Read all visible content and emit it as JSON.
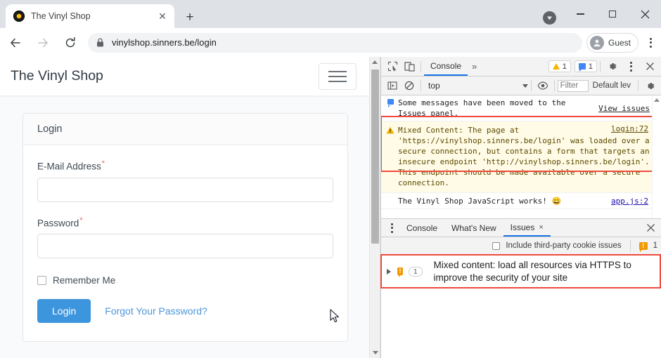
{
  "browser": {
    "tab": {
      "title": "The Vinyl Shop",
      "close_icon": "close-icon",
      "favicon": "vinyl-record-favicon"
    },
    "new_tab_label": "+",
    "window_controls": {
      "minimize": "minimize-icon",
      "maximize": "maximize-icon",
      "close": "close-icon"
    },
    "download_indicator": "download-icon",
    "nav": {
      "back": "back-arrow-icon",
      "forward": "forward-arrow-icon",
      "reload": "reload-icon"
    },
    "omnibox": {
      "lock_icon": "lock-icon",
      "host": "vinylshop.sinners.be",
      "path": "/login",
      "full_url": "vinylshop.sinners.be/login"
    },
    "profile": {
      "label": "Guest",
      "avatar": "person-avatar-icon"
    },
    "menu_icon": "kebab-menu-icon"
  },
  "page": {
    "brand": "The Vinyl Shop",
    "nav_toggle": "hamburger-menu-icon",
    "card": {
      "title": "Login",
      "fields": [
        {
          "label": "E-Mail Address",
          "required": "*",
          "value": "",
          "placeholder": ""
        },
        {
          "label": "Password",
          "required": "*",
          "value": "",
          "placeholder": ""
        }
      ],
      "remember_me": "Remember Me",
      "login_button": "Login",
      "forgot_link": "Forgot Your Password?"
    },
    "colors": {
      "primary": "#3d95dd",
      "link": "#4e96d9",
      "required": "#e3685e"
    }
  },
  "devtools": {
    "toolbar": {
      "inspect_icon": "inspect-element-icon",
      "device_icon": "device-toolbar-icon",
      "active_tab": "Console",
      "more_tabs": "»",
      "warning_badge": "1",
      "message_badge": "1",
      "settings_icon": "gear-icon",
      "more_icon": "kebab-menu-icon",
      "close_icon": "close-icon"
    },
    "console_toolbar": {
      "sidebar_icon": "console-sidebar-icon",
      "clear_icon": "clear-console-icon",
      "context": "top",
      "eye_icon": "live-expression-icon",
      "filter_placeholder": "Filter",
      "level": "Default lev",
      "settings_icon": "gear-icon"
    },
    "messages": [
      {
        "type": "info",
        "icon": "info-message-icon",
        "text": "Some messages have been moved to the Issues panel.",
        "action": "View issues",
        "source": ""
      },
      {
        "type": "warning",
        "icon": "warning-triangle-icon",
        "text": "Mixed Content: The page at 'https://vinylshop.sinners.be/login' was loaded over a secure connection, but contains a form that targets an insecure endpoint 'http://vinylshop.sinners.be/login'. This endpoint should be made available over a secure connection.",
        "source": "login:72",
        "highlighted": true
      },
      {
        "type": "log",
        "icon": "",
        "text": "The Vinyl Shop JavaScript works! 😀",
        "source": "app.js:2"
      }
    ],
    "drawer": {
      "menu_icon": "kebab-menu-icon",
      "tabs": [
        {
          "label": "Console",
          "active": false
        },
        {
          "label": "What's New",
          "active": false
        },
        {
          "label": "Issues",
          "active": true,
          "closable": "×"
        }
      ],
      "close_icon": "close-icon",
      "third_party_checkbox": "Include third-party cookie issues",
      "issue_badge_icon": "issue-warning-icon",
      "issue_badge_count": "1",
      "issues": [
        {
          "expander": "expand-triangle-icon",
          "icon": "issue-warning-icon",
          "count": "1",
          "title": "Mixed content: load all resources via HTTPS to improve the security of your site",
          "highlighted": true
        }
      ]
    }
  }
}
